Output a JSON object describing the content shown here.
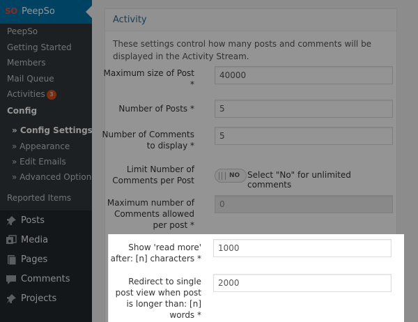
{
  "sidebar": {
    "plugin_logo": "SO",
    "plugin_title": "PeepSo",
    "submenu": [
      {
        "label": "PeepSo"
      },
      {
        "label": "Getting Started"
      },
      {
        "label": "Members"
      },
      {
        "label": "Mail Queue"
      },
      {
        "label": "Activities",
        "badge": "3"
      },
      {
        "label": "Config"
      },
      {
        "label": "» Config Settings"
      },
      {
        "label": "» Appearance"
      },
      {
        "label": "» Edit Emails"
      },
      {
        "label": "» Advanced Options"
      },
      {
        "label": "Reported Items"
      }
    ],
    "menu": [
      {
        "label": "Posts",
        "icon": "pin-icon"
      },
      {
        "label": "Media",
        "icon": "media-icon"
      },
      {
        "label": "Pages",
        "icon": "pages-icon"
      },
      {
        "label": "Comments",
        "icon": "comment-icon"
      },
      {
        "label": "Projects",
        "icon": "pin-icon"
      }
    ]
  },
  "panel": {
    "title": "Activity",
    "description": "These settings control how many posts and comments will be displayed in the Activity Stream.",
    "fields": [
      {
        "label": "Maximum size of Post *",
        "value": "40000"
      },
      {
        "label": "Number of Posts *",
        "value": "5"
      },
      {
        "label": "Number of Comments to display *",
        "value": "5"
      },
      {
        "label": "Limit Number of Comments per Post",
        "toggle": "NO",
        "note": "Select \"No\" for unlimited comments"
      },
      {
        "label": "Maximum number of Comments allowed per post *",
        "value": "0"
      },
      {
        "label": "Show 'read more' after: [n] characters *",
        "value": "1000"
      },
      {
        "label": "Redirect to single post view when post is longer than: [n] words *",
        "value": "2000"
      }
    ]
  },
  "colors": {
    "sidebar_bg": "#23282d",
    "submenu_bg": "#32373c",
    "accent": "#0073aa",
    "badge": "#d54e21",
    "panel_title": "#2e6b8e"
  }
}
